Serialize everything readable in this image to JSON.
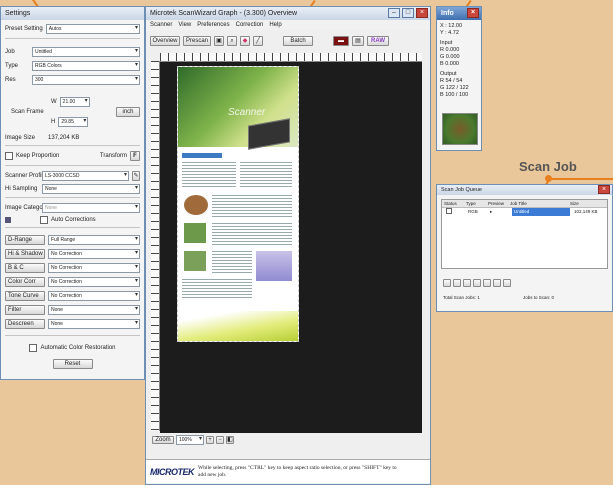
{
  "settings": {
    "title": "Settings",
    "preset_label": "Preset Setting",
    "preset_value": "Autos",
    "job_label": "Job",
    "job_value": "Untitled",
    "type_label": "Type",
    "type_value": "RGB Colors",
    "res_label": "Res",
    "res_value": "300",
    "scanframe_label": "Scan Frame",
    "w_label": "W",
    "w_value": "21.00",
    "h_label": "H",
    "h_value": "29.85",
    "unit_value": "inch",
    "imagesize_label": "Image Size",
    "imagesize_value": "137,204 KB",
    "keep_proportion_label": "Keep Proportion",
    "transform_label": "Transform",
    "scanner_profile_label": "Scanner Profile",
    "scanner_profile_value": "LS-3000 CCSD",
    "hisampling_label": "Hi Sampling",
    "hisampling_value": "None",
    "image_category_label": "Image Category",
    "image_category_value": "None",
    "auto_corrections_label": "Auto Corrections",
    "tools": [
      {
        "label": "D-Range",
        "value": "Full Range"
      },
      {
        "label": "Hi & Shadow",
        "value": "No Correction"
      },
      {
        "label": "B & C",
        "value": "No Correction"
      },
      {
        "label": "Color Corr",
        "value": "No Correction"
      },
      {
        "label": "Tone Curve",
        "value": "No Correction"
      },
      {
        "label": "Filter",
        "value": "None"
      },
      {
        "label": "Descreen",
        "value": "None"
      }
    ],
    "auto_restore_label": "Automatic Color Restoration",
    "reset_label": "Reset"
  },
  "main": {
    "title": "Microtek ScanWizard Graph - (3.300) Overview",
    "menu": [
      "Scanner",
      "View",
      "Preferences",
      "Correction",
      "Help"
    ],
    "overview_label": "Overview",
    "prescan_label": "Prescan",
    "batch_label": "Batch",
    "raw_label": "RAW",
    "zoom_label": "Zoom",
    "zoom_value": "100%",
    "status_text": "While selecting, press \"CTRL\" key to keep aspect ratio selection, or press \"SHIFT\" key to add new job.",
    "logo": "MICROTEK",
    "doc_heading": "Scanner"
  },
  "info": {
    "title": "Info",
    "x_label": "X",
    "x_value": "12.00",
    "y_label": "Y",
    "y_value": "4.72",
    "input_label": "Input",
    "input_values": [
      "R  0.000",
      "G  0.000",
      "B  0.000"
    ],
    "output_label": "Output",
    "output_values": [
      "R  54  /  54",
      "G  122 / 122",
      "B  100 / 100"
    ]
  },
  "queue": {
    "title": "Scan Job Queue",
    "columns": [
      "Status",
      "Type",
      "Preview",
      "Job Title",
      "Size"
    ],
    "row": {
      "type": "RGB",
      "job_title": "Untitled",
      "size": "102,149 KB"
    },
    "footer_left": "Total Scan Jobs: 1",
    "footer_right": "Jobs to Scan: 0"
  },
  "callouts": {
    "scan_job": "Scan Job"
  }
}
